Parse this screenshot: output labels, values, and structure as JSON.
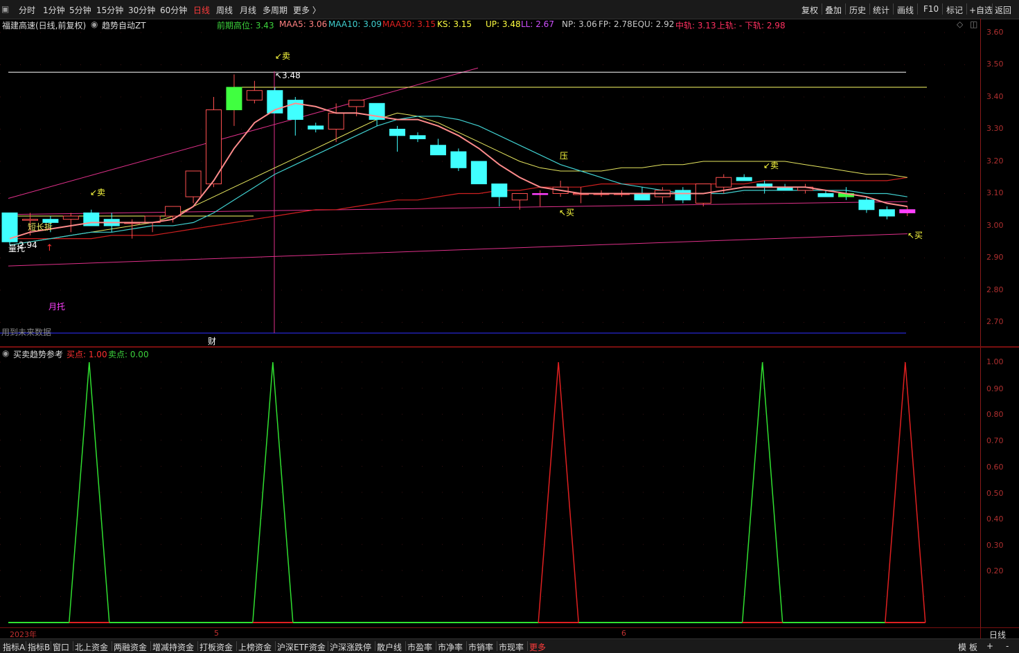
{
  "toolbar": {
    "periods": [
      "分时",
      "1分钟",
      "5分钟",
      "15分钟",
      "30分钟",
      "60分钟",
      "日线",
      "周线",
      "月线",
      "多周期",
      "更多 〉"
    ],
    "active_period": "日线",
    "right_buttons": [
      "复权",
      "叠加",
      "历史",
      "统计",
      "画线",
      "F10",
      "标记",
      "+自选",
      "返回"
    ]
  },
  "header": {
    "stock": "福建高速(日线,前复权)",
    "indicator": "趋势自动ZT",
    "values": [
      {
        "label": "前期高位: 3.43",
        "color": "#3cd23c"
      },
      {
        "label": "MAA5: 3.06",
        "color": "#ff8080"
      },
      {
        "label": "MAA10: 3.09",
        "color": "#40d0d0"
      },
      {
        "label": "MAA30: 3.15",
        "color": "#e02020"
      },
      {
        "label": "KS: 3.15",
        "color": "#ffff40"
      },
      {
        "label": "UP: 3.48",
        "color": "#ffff40"
      },
      {
        "label": "LL: 2.67",
        "color": "#d050ff"
      },
      {
        "label": "NP: 3.06",
        "color": "#c8c8c8"
      },
      {
        "label": "FP: 2.78",
        "color": "#c8c8c8"
      },
      {
        "label": "EQU: 2.92",
        "color": "#c8c8c8"
      },
      {
        "label": "中轨: 3.13",
        "color": "#ff3060"
      },
      {
        "label": "上轨: -",
        "color": "#ff3060"
      },
      {
        "label": "下轨: 2.98",
        "color": "#ff3060"
      }
    ]
  },
  "price_axis": [
    "3.60",
    "3.50",
    "3.40",
    "3.30",
    "3.20",
    "3.10",
    "3.00",
    "2.90",
    "2.80",
    "2.70"
  ],
  "indicator_axis": [
    "1.00",
    "0.90",
    "0.80",
    "0.70",
    "0.60",
    "0.50",
    "0.40",
    "0.30",
    "0.20"
  ],
  "chart_labels": {
    "high_value": "3.48",
    "low_value": "2.94",
    "sell": "卖",
    "buy": "买",
    "press": "压",
    "short_long": "短长拆",
    "volume_support": "量托",
    "month_support": "月托",
    "future_data": "用到未来数据",
    "finance": "财"
  },
  "lower_panel": {
    "title": "买卖趋势参考",
    "buy_label": "买点: 1.00",
    "sell_label": "卖点: 0.00"
  },
  "date_axis": [
    "2023年",
    "5",
    "6"
  ],
  "period_label": "日线",
  "bottom_tabs": [
    "指标A",
    "指标B",
    "窗口",
    "北上资金",
    "两融资金",
    "增减持资金",
    "打板资金",
    "上榜资金",
    "沪深ETF资金",
    "沪深涨跌停",
    "散户线",
    "市盈率",
    "市净率",
    "市销率",
    "市现率",
    "更多"
  ],
  "bottom_right": [
    "模",
    "板",
    "+",
    "-"
  ],
  "chart_data": {
    "type": "candlestick",
    "ohlc": [
      [
        3.04,
        3.04,
        2.94,
        2.95
      ],
      [
        3.02,
        3.04,
        2.97,
        3.02
      ],
      [
        3.02,
        3.03,
        2.98,
        3.01
      ],
      [
        3.02,
        3.04,
        2.98,
        3.03
      ],
      [
        3.04,
        3.05,
        3.0,
        3.0
      ],
      [
        3.02,
        3.04,
        2.98,
        3.0
      ],
      [
        3.01,
        3.02,
        2.96,
        3.01
      ],
      [
        3.01,
        3.03,
        2.98,
        3.03
      ],
      [
        3.03,
        3.06,
        3.01,
        3.06
      ],
      [
        3.09,
        3.17,
        3.07,
        3.17
      ],
      [
        3.13,
        3.4,
        3.12,
        3.36
      ],
      [
        3.36,
        3.47,
        3.31,
        3.43
      ],
      [
        3.39,
        3.45,
        3.38,
        3.42
      ],
      [
        3.42,
        3.43,
        3.35,
        3.35
      ],
      [
        3.39,
        3.4,
        3.28,
        3.33
      ],
      [
        3.31,
        3.32,
        3.29,
        3.3
      ],
      [
        3.3,
        3.38,
        3.26,
        3.35
      ],
      [
        3.37,
        3.38,
        3.34,
        3.39
      ],
      [
        3.38,
        3.38,
        3.31,
        3.33
      ],
      [
        3.3,
        3.31,
        3.23,
        3.28
      ],
      [
        3.28,
        3.29,
        3.26,
        3.27
      ],
      [
        3.25,
        3.27,
        3.23,
        3.22
      ],
      [
        3.23,
        3.24,
        3.17,
        3.18
      ],
      [
        3.2,
        3.2,
        3.13,
        3.13
      ],
      [
        3.13,
        3.13,
        3.06,
        3.09
      ],
      [
        3.08,
        3.1,
        3.05,
        3.1
      ],
      [
        3.1,
        3.11,
        3.06,
        3.1
      ],
      [
        3.1,
        3.14,
        3.09,
        3.12
      ],
      [
        3.1,
        3.12,
        3.07,
        3.1
      ],
      [
        3.1,
        3.11,
        3.09,
        3.1
      ],
      [
        3.1,
        3.11,
        3.09,
        3.1
      ],
      [
        3.1,
        3.12,
        3.08,
        3.08
      ],
      [
        3.09,
        3.12,
        3.07,
        3.11
      ],
      [
        3.11,
        3.12,
        3.07,
        3.08
      ],
      [
        3.07,
        3.13,
        3.06,
        3.13
      ],
      [
        3.12,
        3.16,
        3.1,
        3.15
      ],
      [
        3.15,
        3.16,
        3.14,
        3.14
      ],
      [
        3.13,
        3.14,
        3.1,
        3.12
      ],
      [
        3.12,
        3.13,
        3.11,
        3.11
      ],
      [
        3.11,
        3.13,
        3.1,
        3.12
      ],
      [
        3.1,
        3.11,
        3.09,
        3.09
      ],
      [
        3.1,
        3.12,
        3.08,
        3.09
      ],
      [
        3.08,
        3.09,
        3.04,
        3.05
      ],
      [
        3.05,
        3.06,
        3.02,
        3.03
      ],
      [
        3.04,
        3.06,
        3.03,
        3.05
      ]
    ],
    "ma5": [
      2.96,
      2.98,
      2.99,
      3.0,
      3.01,
      3.01,
      3.01,
      3.01,
      3.02,
      3.06,
      3.14,
      3.24,
      3.32,
      3.36,
      3.38,
      3.37,
      3.35,
      3.35,
      3.34,
      3.33,
      3.33,
      3.31,
      3.28,
      3.24,
      3.19,
      3.15,
      3.12,
      3.11,
      3.1,
      3.1,
      3.1,
      3.1,
      3.1,
      3.1,
      3.1,
      3.11,
      3.12,
      3.12,
      3.12,
      3.12,
      3.11,
      3.1,
      3.09,
      3.07,
      3.06
    ],
    "ma10": [
      2.94,
      2.95,
      2.96,
      2.97,
      2.98,
      2.98,
      2.99,
      3.0,
      3.0,
      3.01,
      3.04,
      3.08,
      3.12,
      3.16,
      3.19,
      3.22,
      3.25,
      3.28,
      3.31,
      3.33,
      3.34,
      3.34,
      3.33,
      3.31,
      3.28,
      3.25,
      3.22,
      3.19,
      3.17,
      3.15,
      3.13,
      3.12,
      3.11,
      3.1,
      3.1,
      3.1,
      3.11,
      3.11,
      3.11,
      3.11,
      3.11,
      3.11,
      3.1,
      3.1,
      3.09
    ],
    "ma30": [
      2.96,
      2.96,
      2.96,
      2.96,
      2.96,
      2.97,
      2.97,
      2.97,
      2.98,
      2.99,
      3.0,
      3.01,
      3.02,
      3.03,
      3.04,
      3.05,
      3.05,
      3.06,
      3.07,
      3.08,
      3.08,
      3.09,
      3.1,
      3.1,
      3.11,
      3.11,
      3.12,
      3.12,
      3.12,
      3.13,
      3.13,
      3.13,
      3.13,
      3.13,
      3.13,
      3.13,
      3.13,
      3.14,
      3.14,
      3.14,
      3.14,
      3.14,
      3.14,
      3.14,
      3.15
    ],
    "ks": [
      2.94,
      2.95,
      2.96,
      2.97,
      2.98,
      2.99,
      3.0,
      3.01,
      3.03,
      3.06,
      3.09,
      3.12,
      3.15,
      3.18,
      3.21,
      3.24,
      3.27,
      3.3,
      3.33,
      3.35,
      3.34,
      3.32,
      3.29,
      3.26,
      3.23,
      3.2,
      3.18,
      3.17,
      3.17,
      3.17,
      3.18,
      3.18,
      3.19,
      3.19,
      3.2,
      3.2,
      3.2,
      3.2,
      3.2,
      3.19,
      3.18,
      3.17,
      3.16,
      3.16,
      3.15
    ],
    "up": 3.48,
    "prior_high": 3.43,
    "signal_buy_days": [
      27,
      44
    ],
    "signal_sell_days": [
      4,
      13,
      37
    ],
    "indicator": {
      "buy_peak_days": [
        27,
        44
      ],
      "sell_peak_days": [
        4,
        13,
        37
      ]
    }
  }
}
